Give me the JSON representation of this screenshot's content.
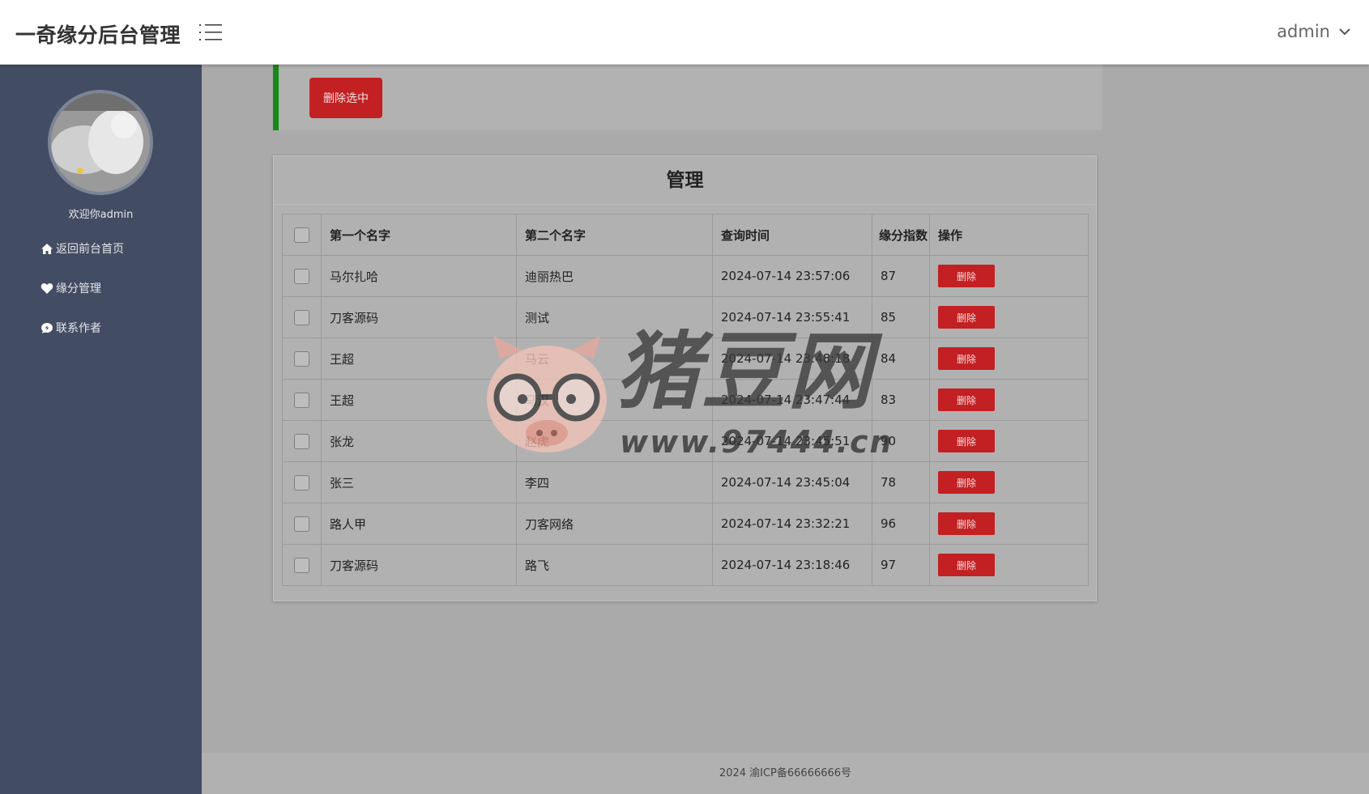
{
  "header": {
    "brand": "一奇缘分后台管理",
    "user_name": "admin",
    "menu_icon": "list-icon",
    "user_dropdown_icon": "chevron-down-icon"
  },
  "sidebar": {
    "welcome": "欢迎你admin",
    "items": [
      {
        "label": "返回前台首页",
        "icon": "home-icon"
      },
      {
        "label": "缘分管理",
        "icon": "heart-icon"
      },
      {
        "label": "联系作者",
        "icon": "chat-icon"
      }
    ]
  },
  "toolbar": {
    "delete_selected_label": "删除选中"
  },
  "panel": {
    "title": "管理",
    "columns": [
      "第一个名字",
      "第二个名字",
      "查询时间",
      "缘分指数",
      "操作"
    ],
    "delete_label": "删除",
    "rows": [
      {
        "first": "马尔扎哈",
        "second": "迪丽热巴",
        "time": "2024-07-14 23:57:06",
        "score": "87"
      },
      {
        "first": "刀客源码",
        "second": "测试",
        "time": "2024-07-14 23:55:41",
        "score": "85"
      },
      {
        "first": "王超",
        "second": "马云",
        "time": "2024-07-14 23:48:18",
        "score": "84"
      },
      {
        "first": "王超",
        "second": "马汉",
        "time": "2024-07-14 23:47:44",
        "score": "83"
      },
      {
        "first": "张龙",
        "second": "赵虎",
        "time": "2024-07-14 23:45:51",
        "score": "90"
      },
      {
        "first": "张三",
        "second": "李四",
        "time": "2024-07-14 23:45:04",
        "score": "78"
      },
      {
        "first": "路人甲",
        "second": "刀客网络",
        "time": "2024-07-14 23:32:21",
        "score": "96"
      },
      {
        "first": "刀客源码",
        "second": "路飞",
        "time": "2024-07-14 23:18:46",
        "score": "97"
      }
    ]
  },
  "footer": {
    "text": "2024 渝ICP备66666666号"
  },
  "watermark": {
    "title": "猪豆网",
    "url": "www.97444.cn"
  },
  "colors": {
    "header_bg": "#ffffff",
    "sidebar_bg": "#424c63",
    "content_bg": "#aaaaaa",
    "danger": "#c22022",
    "accent_green": "#168a16"
  }
}
